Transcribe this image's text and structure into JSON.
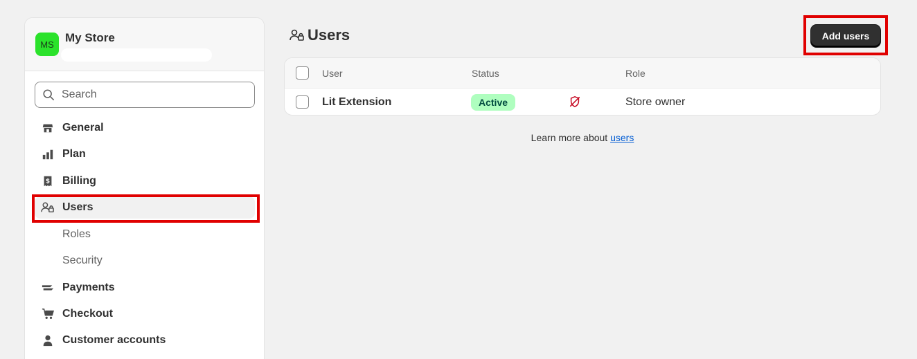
{
  "sidebar": {
    "store": {
      "initials": "MS",
      "name": "My Store"
    },
    "search": {
      "placeholder": "Search"
    },
    "items": [
      {
        "label": "General",
        "icon": "store-icon"
      },
      {
        "label": "Plan",
        "icon": "plan-icon"
      },
      {
        "label": "Billing",
        "icon": "billing-icon"
      },
      {
        "label": "Users",
        "icon": "users-icon",
        "active": true
      },
      {
        "label": "Roles",
        "sub": true
      },
      {
        "label": "Security",
        "sub": true
      },
      {
        "label": "Payments",
        "icon": "payments-icon"
      },
      {
        "label": "Checkout",
        "icon": "cart-icon"
      },
      {
        "label": "Customer accounts",
        "icon": "person-icon"
      }
    ]
  },
  "header": {
    "title": "Users",
    "add_label": "Add users"
  },
  "table": {
    "columns": [
      "User",
      "Status",
      "Role"
    ],
    "rows": [
      {
        "user": "Lit Extension",
        "status": "Active",
        "role": "Store owner"
      }
    ]
  },
  "footer": {
    "text": "Learn more about",
    "link": "users"
  },
  "colors": {
    "accent_highlight": "#e00000",
    "avatar_bg": "#2be22b",
    "badge_bg": "#affebf",
    "link": "#005bd3"
  }
}
